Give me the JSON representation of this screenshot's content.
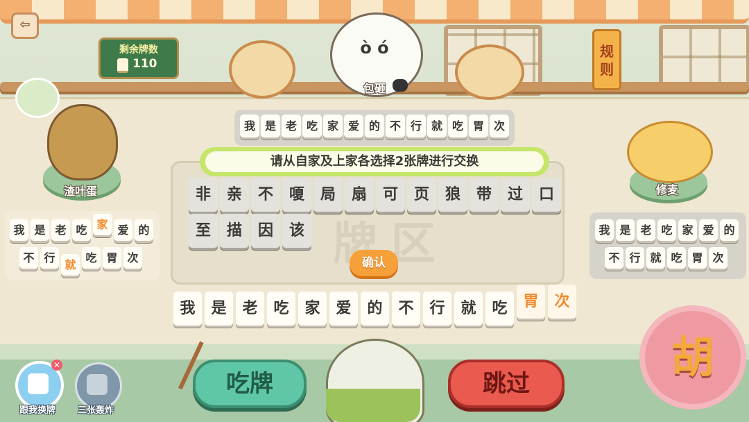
{
  "topbar": {
    "back_icon": "exit-icon",
    "remaining_label": "剩余牌数",
    "remaining_count": "110",
    "rules_label": "规则"
  },
  "players": {
    "top": {
      "name": "包砸",
      "hand": [
        "我",
        "是",
        "老",
        "吃",
        "家",
        "爱",
        "的",
        "不",
        "行",
        "就",
        "吃",
        "胃",
        "次"
      ]
    },
    "left": {
      "name": "渣叶蛋",
      "hand_row1": [
        "我",
        "是",
        "老",
        "吃",
        "家",
        "爱",
        "的"
      ],
      "hand_row2": [
        "不",
        "行",
        "就",
        "吃",
        "胃",
        "次"
      ],
      "highlighted": [
        "家",
        "就"
      ]
    },
    "right": {
      "name": "修麦",
      "hand_row1": [
        "我",
        "是",
        "老",
        "吃",
        "家",
        "爱",
        "的"
      ],
      "hand_row2": [
        "不",
        "行",
        "就",
        "吃",
        "胃",
        "次"
      ]
    }
  },
  "prompt": "请从自家及上家各选择2张牌进行交换",
  "pool": {
    "row1": [
      "非",
      "亲",
      "不",
      "嗄",
      "局",
      "扇",
      "可",
      "页",
      "狼",
      "带",
      "过",
      "口"
    ],
    "row2": [
      "至",
      "描",
      "因",
      "该"
    ],
    "watermark": "牌区"
  },
  "confirm_label": "确认",
  "my_hand": {
    "tiles": [
      "我",
      "是",
      "老",
      "吃",
      "家",
      "爱",
      "的",
      "不",
      "行",
      "就",
      "吃",
      "胃",
      "次"
    ],
    "selected": [
      "胃",
      "次"
    ]
  },
  "actions": {
    "chi_label": "吃牌",
    "pass_label": "跳过",
    "hu_label": "胡"
  },
  "skills": [
    {
      "label": "跟我换牌",
      "icon": "swap-card-icon"
    },
    {
      "label": "三张轰炸",
      "icon": "bomb-icon"
    }
  ],
  "colors": {
    "prompt_border": "#c5e66a",
    "chi_button": "#5fc6a8",
    "pass_button": "#ea5a4e",
    "hu_button": "#ef9aa2",
    "highlight_text": "#f28a2b"
  }
}
